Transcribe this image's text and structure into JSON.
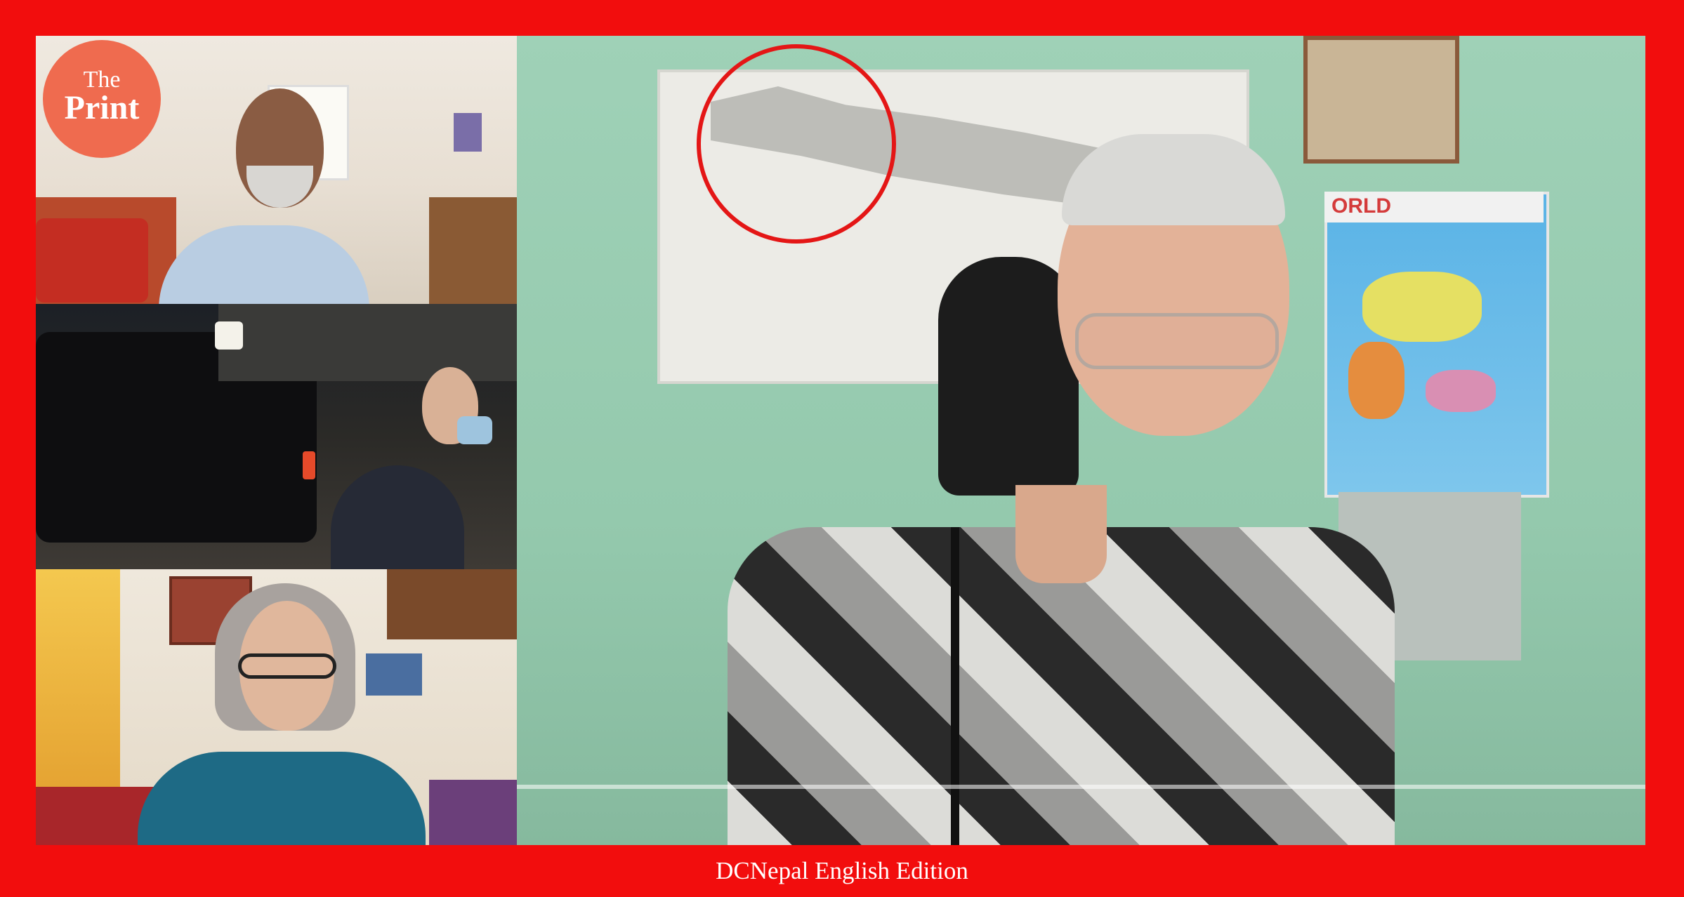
{
  "logo": {
    "line1": "The",
    "line2": "Print"
  },
  "main_video": {
    "map_word": "ORLD"
  },
  "caption": "DCNepal English Edition",
  "colors": {
    "frame": "#f20d0d",
    "logo_bg": "#ef6b4f",
    "highlight": "#e41616"
  },
  "icons": {
    "logo": "theprint-logo"
  }
}
